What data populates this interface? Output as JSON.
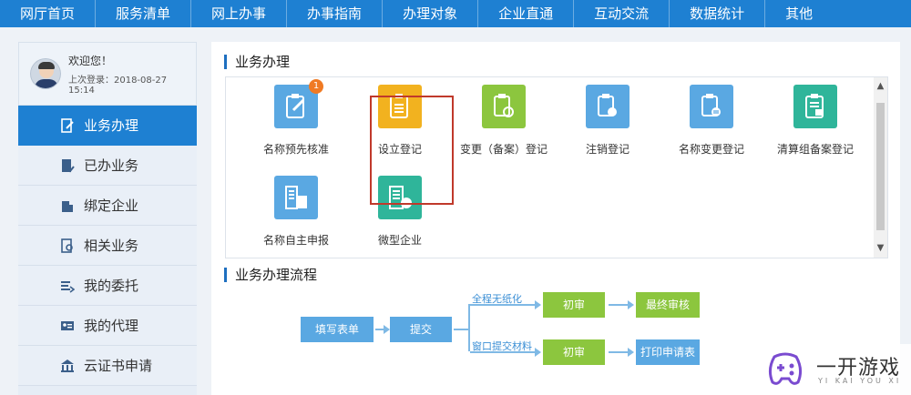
{
  "topnav": [
    "网厅首页",
    "服务清单",
    "网上办事",
    "办事指南",
    "办理对象",
    "企业直通",
    "互动交流",
    "数据统计",
    "其他"
  ],
  "user": {
    "welcome": "欢迎您！",
    "last_login": "上次登录：2018-08-27 15:14"
  },
  "sidebar": [
    {
      "label": "业务办理",
      "icon": "edit-doc-icon",
      "active": true
    },
    {
      "label": "已办业务",
      "icon": "done-doc-icon",
      "active": false
    },
    {
      "label": "绑定企业",
      "icon": "building-icon",
      "active": false
    },
    {
      "label": "相关业务",
      "icon": "search-doc-icon",
      "active": false
    },
    {
      "label": "我的委托",
      "icon": "entrust-icon",
      "active": false
    },
    {
      "label": "我的代理",
      "icon": "id-card-icon",
      "active": false
    },
    {
      "label": "云证书申请",
      "icon": "bank-icon",
      "active": false
    }
  ],
  "section1": {
    "title": "业务办理"
  },
  "tiles": [
    {
      "label": "名称预先核准",
      "color": "#5aa8e2",
      "icon": "edit-clipboard-icon",
      "badge": "1"
    },
    {
      "label": "设立登记",
      "color": "#f2b21f",
      "icon": "clipboard-icon"
    },
    {
      "label": "变更（备案）登记",
      "color": "#8cc63e",
      "icon": "refresh-clipboard-icon"
    },
    {
      "label": "注销登记",
      "color": "#5aa8e2",
      "icon": "cancel-clipboard-icon"
    },
    {
      "label": "名称变更登记",
      "color": "#5aa8e2",
      "icon": "list-clipboard-icon"
    },
    {
      "label": "清算组备案登记",
      "color": "#2fb59a",
      "icon": "filed-clipboard-icon"
    },
    {
      "label": "名称自主申报",
      "color": "#5aa8e2",
      "icon": "building-declare-icon"
    },
    {
      "label": "微型企业",
      "color": "#2fb59a",
      "icon": "micro-building-icon"
    }
  ],
  "section2": {
    "title": "业务办理流程"
  },
  "flow": {
    "fill_form": "填写表单",
    "submit": "提交",
    "branch_top": "全程无纸化",
    "branch_bottom": "窗口提交材料",
    "first_review_top": "初审",
    "final_review": "最终审核",
    "first_review_bottom": "初审",
    "print_form": "打印申请表"
  },
  "watermark": {
    "text": "一开游戏",
    "sub": "YI KAI YOU XI"
  }
}
